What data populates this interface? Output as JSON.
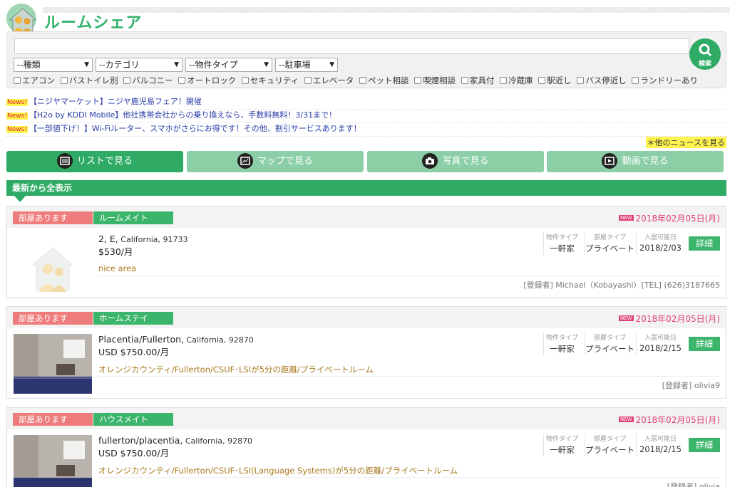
{
  "header": {
    "title": "ルームシェア"
  },
  "search": {
    "placeholder": "",
    "button_label": "検索",
    "selects": [
      "--種類",
      "--カテゴリ",
      "--物件タイプ",
      "--駐車場"
    ],
    "checks": [
      "エアコン",
      "バストイレ別",
      "バルコニー",
      "オートロック",
      "セキュリティ",
      "エレベータ",
      "ペット相談",
      "喫煙相談",
      "家具付",
      "冷蔵庫",
      "駅近し",
      "バス停近し",
      "ランドリーあり"
    ]
  },
  "news": {
    "tag": "News!",
    "items": [
      "【ニジヤマーケット】ニジヤ鹿児島フェア！開催",
      "【H2o by KDDI Mobile】他社携帯会社からの乗り換えなら、手数料無料！3/31まで！",
      "【一部値下げ！】Wi-Fiルーター、スマホがさらにお得です！その他、割引サービスあります！"
    ],
    "more": "＊他のニュースを見る"
  },
  "tabs": [
    "リストで見る",
    "マップで見る",
    "写真で見る",
    "動画で見る"
  ],
  "section_title": "最新から全表示",
  "labels": {
    "type": "物件タイプ",
    "room": "部屋タイプ",
    "avail": "入居可能日",
    "detail": "詳細",
    "new": "NEW"
  },
  "listings": [
    {
      "status": "部屋あります",
      "category": "ルームメイト",
      "date": "2018年02月05日(月)",
      "title": "2, E,",
      "location": " California, 91733",
      "price": "$530/月",
      "desc": "nice area",
      "type": "一軒家",
      "room": "プライベート",
      "avail": "2018/2/03",
      "registrant": "[登録者] Michael（Kobayashi）[TEL] (626)3187665"
    },
    {
      "status": "部屋あります",
      "category": "ホームステイ",
      "date": "2018年02月05日(月)",
      "title": "Placentia/Fullerton,",
      "location": " California, 92870",
      "price": "USD $750.00/月",
      "desc": "オレンジカウンティ/Fullerton/CSUF･LSIが5分の距離/プライベートルーム",
      "type": "一軒家",
      "room": "プライベート",
      "avail": "2018/2/15",
      "registrant": "[登録者] olivia9"
    },
    {
      "status": "部屋あります",
      "category": "ハウスメイト",
      "date": "2018年02月05日(月)",
      "title": "fullerton/placentia,",
      "location": " California, 92870",
      "price": "USD $750.00/月",
      "desc": "オレンジカウンティ/Fullerton/CSUF･LSI(Language Systems)が5分の距離/プライベートルーム",
      "type": "一軒家",
      "room": "プライベート",
      "avail": "2018/2/15",
      "registrant": "[登録者] olivia"
    }
  ],
  "colors": {
    "brand": "#2fab65",
    "pink": "#ee7c7c",
    "date": "#e0407a",
    "tab_inactive": "#8ccfa6"
  }
}
